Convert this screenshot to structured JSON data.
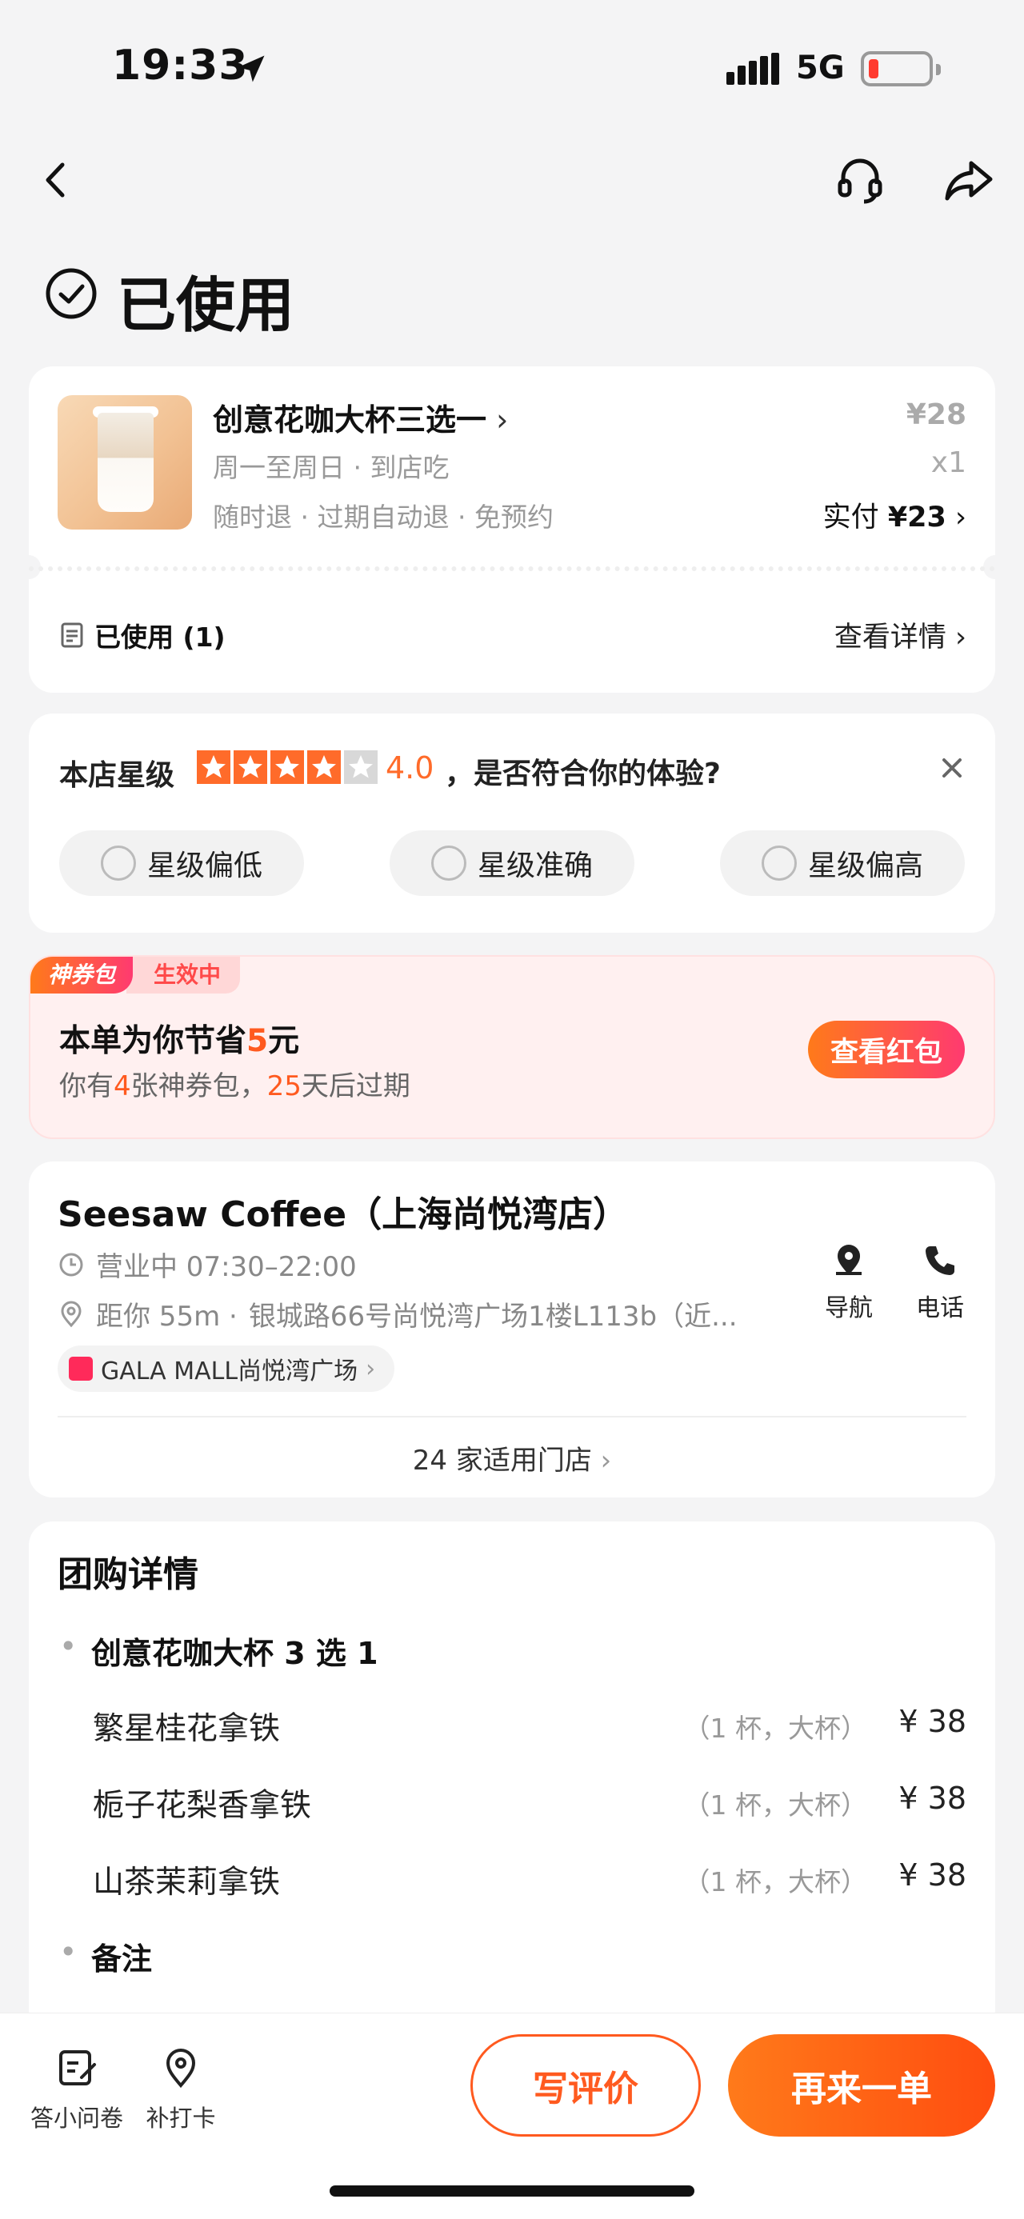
{
  "status_bar": {
    "time": "19:33",
    "network": "5G"
  },
  "header": {
    "title": "已使用"
  },
  "deal": {
    "title": "创意花咖大杯三选一",
    "subtitle1": "周一至周日 · 到店吃",
    "subtitle2": "随时退 · 过期自动退 · 免预约",
    "original_price": "¥28",
    "quantity": "x1",
    "paid_label": "实付",
    "paid_amount": "¥23",
    "used_label": "已使用 (1)",
    "detail_link": "查看详情"
  },
  "rating": {
    "label": "本店星级",
    "stars": 4,
    "score": "4.0",
    "question": "，是否符合你的体验?",
    "options": [
      "星级偏低",
      "星级准确",
      "星级偏高"
    ]
  },
  "coupon": {
    "tag_name": "神券包",
    "tag_status": "生效中",
    "save_prefix": "本单为你节省",
    "save_amount": "5",
    "save_suffix": "元",
    "sub_prefix": "你有",
    "count": "4",
    "sub_mid": "张神券包，",
    "days": "25",
    "sub_suffix": "天后过期",
    "button": "查看红包"
  },
  "store": {
    "name": "Seesaw Coffee（上海尚悦湾店）",
    "hours": "营业中 07:30–22:00",
    "distance": "距你 55m ·",
    "address": "银城路66号尚悦湾广场1楼L113b（近...",
    "mall": "GALA MALL尚悦湾广场",
    "nav_label": "导航",
    "phone_label": "电话",
    "stores_count": "24 家适用门店"
  },
  "group_details": {
    "title": "团购详情",
    "section": "创意花咖大杯 3 选 1",
    "items": [
      {
        "name": "繁星桂花拿铁",
        "spec": "（1 杯，大杯）",
        "price": "¥ 38"
      },
      {
        "name": "栀子花梨香拿铁",
        "spec": "（1 杯，大杯）",
        "price": "¥ 38"
      },
      {
        "name": "山茶茉莉拿铁",
        "spec": "（1 杯，大杯）",
        "price": "¥ 38"
      }
    ],
    "note_heading": "备注"
  },
  "bottom_bar": {
    "survey": "答小问卷",
    "checkin": "补打卡",
    "review": "写评价",
    "reorder": "再来一单"
  },
  "colors": {
    "accent": "#ff5a1f",
    "pink": "#ff3a70"
  }
}
